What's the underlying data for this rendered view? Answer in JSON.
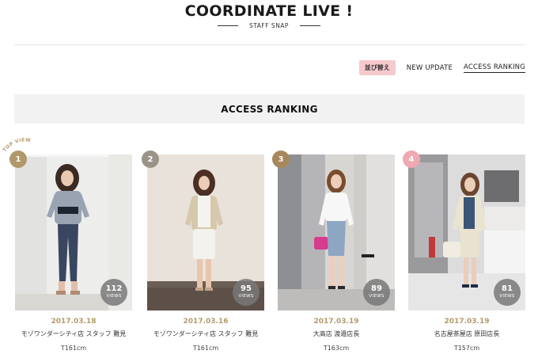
{
  "header": {
    "title": "COORDINATE LIVE !",
    "subtitle": "STAFF SNAP"
  },
  "sort": {
    "badge_label": "並び替え",
    "options": [
      {
        "label": "NEW UPDATE",
        "active": false
      },
      {
        "label": "ACCESS RANKING",
        "active": true
      }
    ]
  },
  "ranking": {
    "title": "ACCESS RANKING",
    "top_views_label": "TOP VIEWS",
    "items": [
      {
        "rank": "1",
        "rank_color": "#b0986a",
        "views": "112",
        "views_unit": "VIEWS",
        "date": "2017.03.18",
        "shop": "モゾワンダーシティ店 スタッフ 難見",
        "height": "T161cm"
      },
      {
        "rank": "2",
        "rank_color": "#9a9488",
        "views": "95",
        "views_unit": "VIEWS",
        "date": "2017.03.16",
        "shop": "モゾワンダーシティ店 スタッフ 難見",
        "height": "T161cm"
      },
      {
        "rank": "3",
        "rank_color": "#a7885a",
        "views": "89",
        "views_unit": "VIEWS",
        "date": "2017.03.19",
        "shop": "大高店 渡邉店長",
        "height": "T163cm"
      },
      {
        "rank": "4",
        "rank_color": "#f0a9b0",
        "views": "81",
        "views_unit": "VIEWS",
        "date": "2017.03.19",
        "shop": "名古屋茶屋店 原田店長",
        "height": "T157cm"
      }
    ]
  }
}
